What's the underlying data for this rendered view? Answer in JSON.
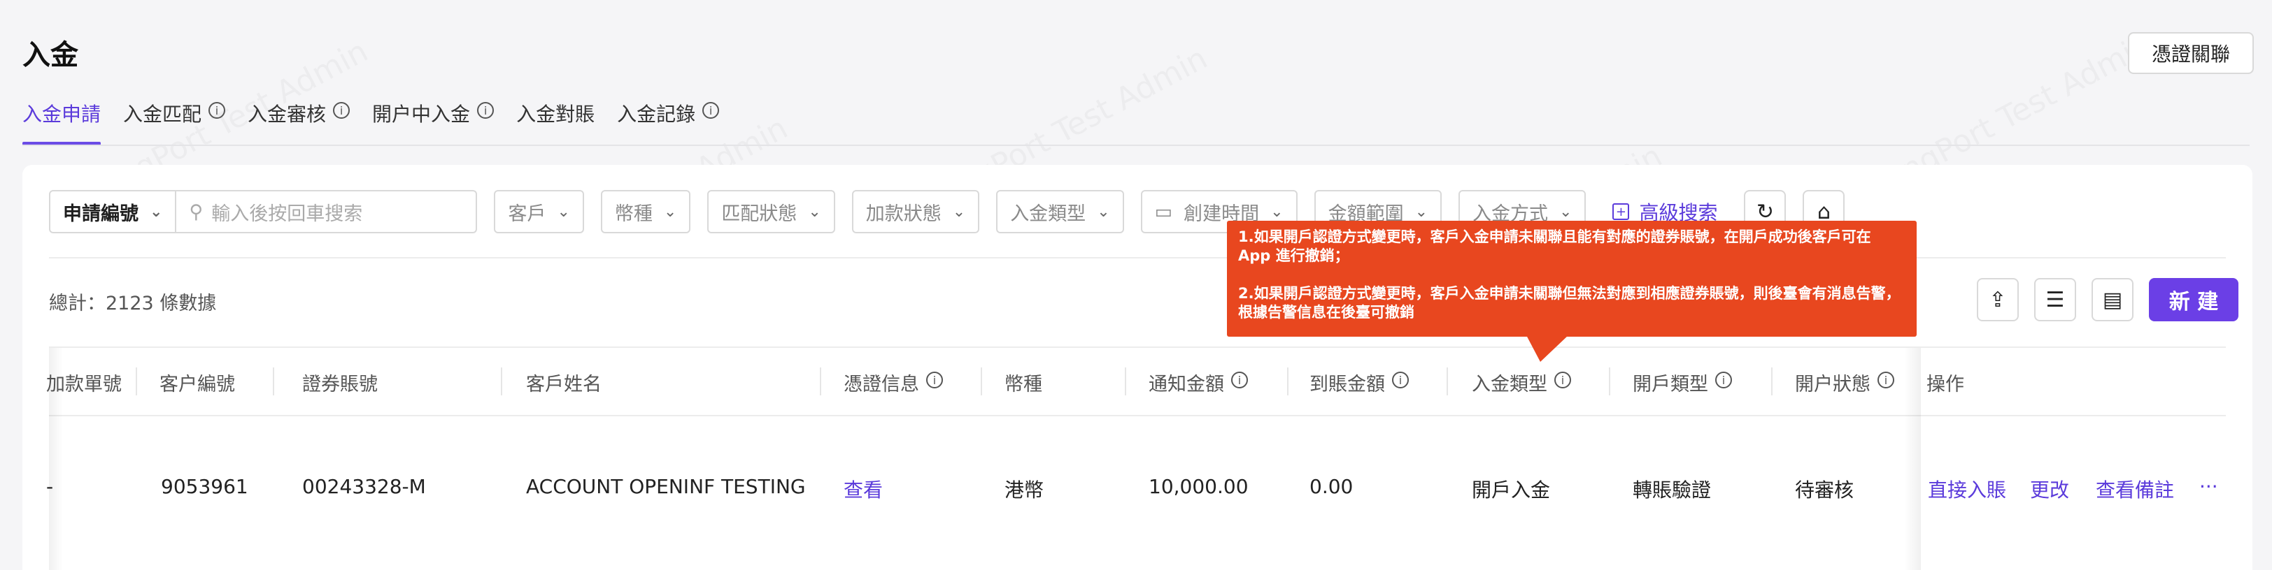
{
  "page": {
    "title": "入金",
    "voucher_button": "憑證關聯"
  },
  "tabs": [
    {
      "label": "入金申請",
      "active": true,
      "info": false
    },
    {
      "label": "入金匹配",
      "active": false,
      "info": true
    },
    {
      "label": "入金審核",
      "active": false,
      "info": true
    },
    {
      "label": "開户中入金",
      "active": false,
      "info": true
    },
    {
      "label": "入金對賬",
      "active": false,
      "info": false
    },
    {
      "label": "入金記錄",
      "active": false,
      "info": true
    }
  ],
  "filters": {
    "search_type": "申請編號",
    "search_placeholder": "輸入後按回車搜索",
    "customer": "客戶",
    "currency": "幣種",
    "match_status": "匹配狀態",
    "deposit_status": "加款狀態",
    "deposit_type": "入金類型",
    "created_time": "創建時間",
    "amount_range": "金額範圍",
    "deposit_method": "入金方式",
    "advanced_search": "高級搜索"
  },
  "summary": {
    "total_text": "總計：2123 條數據"
  },
  "toolbar": {
    "new_button": "新 建"
  },
  "table": {
    "columns": {
      "payment_no": "加款單號",
      "customer_no": "客户編號",
      "securities_account": "證券賬號",
      "customer_name": "客戶姓名",
      "voucher_info": "憑證信息",
      "currency": "幣種",
      "notified_amount": "通知金額",
      "received_amount": "到賬金額",
      "deposit_type": "入金類型",
      "account_opening_type": "開戶類型",
      "account_opening_status": "開户狀態",
      "actions": "操作"
    },
    "rows": [
      {
        "payment_no": "-",
        "customer_no": "9053961",
        "securities_account": "00243328-M",
        "customer_name": "ACCOUNT OPENINF TESTING",
        "voucher_info": "查看",
        "currency": "港幣",
        "notified_amount": "10,000.00",
        "received_amount": "0.00",
        "deposit_type": "開戶入金",
        "account_opening_type": "轉賬驗證",
        "account_opening_status": "待審核",
        "actions": [
          "直接入賬",
          "更改",
          "查看備註",
          "···"
        ]
      }
    ]
  },
  "tooltip": {
    "line1": "1.如果開戶認證方式變更時，客戶入金申請未關聯且能有對應的證券賬號，在開戶成功後客戶可在 App 進行撤銷；",
    "line2": "2.如果開戶認證方式變更時，客戶入金申請未關聯但無法對應到相應證券賬號，則後臺會有消息告警，根據告警信息在後臺可撤銷"
  },
  "watermark": "LongPort Test Admin",
  "colors": {
    "accent": "#6b3fe6",
    "tooltip_bg": "#e8471f"
  }
}
